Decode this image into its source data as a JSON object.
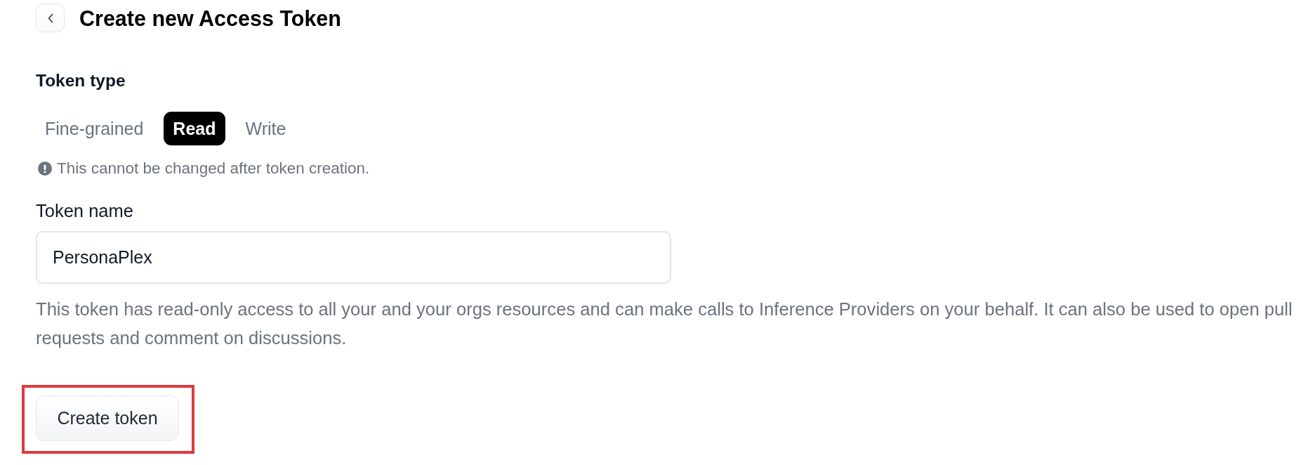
{
  "header": {
    "title": "Create new Access Token"
  },
  "token_type": {
    "label": "Token type",
    "options": [
      {
        "label": "Fine-grained",
        "selected": false
      },
      {
        "label": "Read",
        "selected": true
      },
      {
        "label": "Write",
        "selected": false
      }
    ],
    "note": "This cannot be changed after token creation."
  },
  "token_name": {
    "label": "Token name",
    "value": "PersonaPlex"
  },
  "description": "This token has read-only access to all your and your orgs resources and can make calls to Inference Providers on your behalf. It can also be used to open pull requests and comment on discussions.",
  "create_button": {
    "label": "Create token",
    "highlighted": true
  }
}
